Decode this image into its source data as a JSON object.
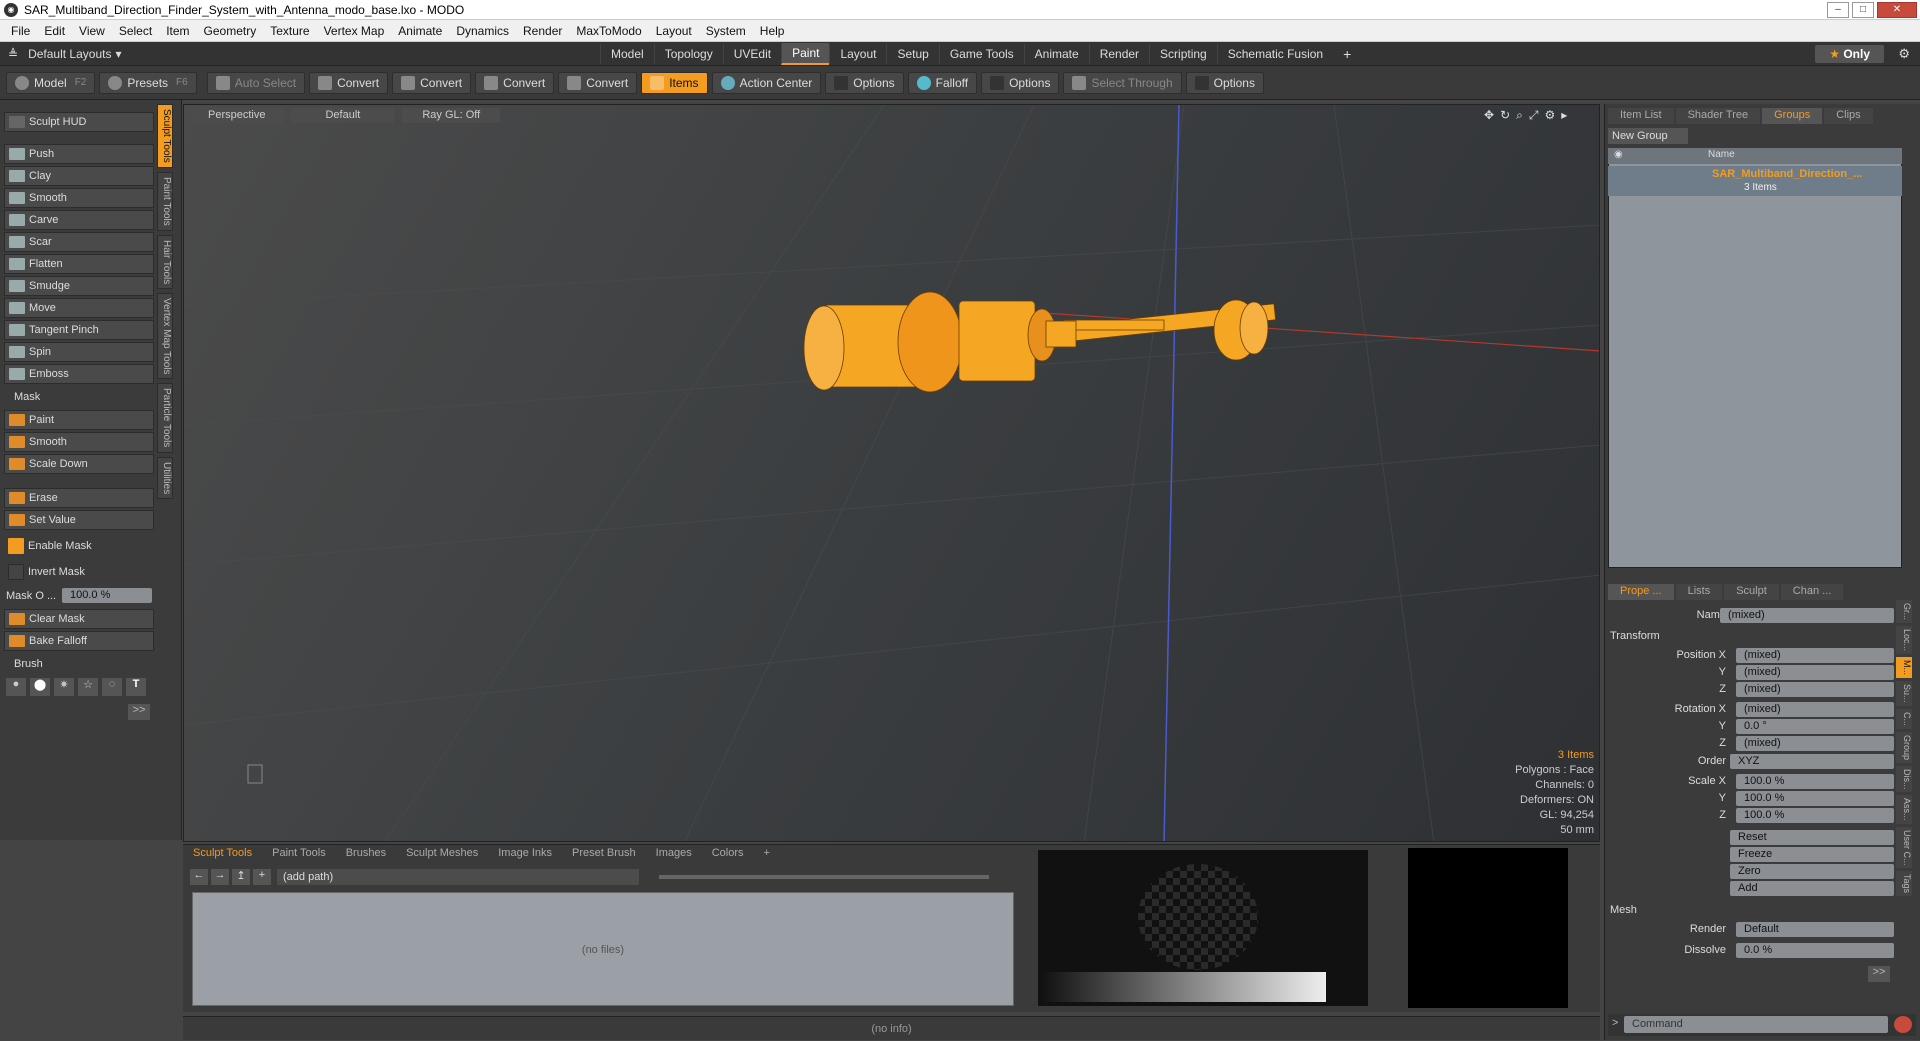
{
  "window": {
    "title": "SAR_Multiband_Direction_Finder_System_with_Antenna_modo_base.lxo - MODO"
  },
  "menu": [
    "File",
    "Edit",
    "View",
    "Select",
    "Item",
    "Geometry",
    "Texture",
    "Vertex Map",
    "Animate",
    "Dynamics",
    "Render",
    "MaxToModo",
    "Layout",
    "System",
    "Help"
  ],
  "layout": {
    "default_layouts": "Default Layouts",
    "tabs": [
      "Model",
      "Topology",
      "UVEdit",
      "Paint",
      "Layout",
      "Setup",
      "Game Tools",
      "Animate",
      "Render",
      "Scripting",
      "Schematic Fusion"
    ],
    "active_tab": "Paint",
    "only_label": "Only"
  },
  "toolbar": {
    "model": "Model",
    "model_key": "F2",
    "presets": "Presets",
    "presets_key": "F6",
    "auto_select": "Auto Select",
    "convert1": "Convert",
    "convert2": "Convert",
    "convert3": "Convert",
    "convert4": "Convert",
    "items": "Items",
    "action_center": "Action Center",
    "options1": "Options",
    "falloff": "Falloff",
    "options2": "Options",
    "select_through": "Select Through",
    "options3": "Options"
  },
  "left": {
    "hud": "Sculpt HUD",
    "tools": [
      "Push",
      "Clay",
      "Smooth",
      "Carve",
      "Scar",
      "Flatten",
      "Smudge",
      "Move",
      "Tangent Pinch",
      "Spin",
      "Emboss"
    ],
    "mask_header": "Mask",
    "mask_tools": [
      "Paint",
      "Smooth",
      "Scale Down"
    ],
    "erase": "Erase",
    "set_value": "Set Value",
    "enable_mask": "Enable Mask",
    "invert_mask": "Invert Mask",
    "mask_opacity_label": "Mask O ...",
    "mask_opacity_value": "100.0 %",
    "clear_mask": "Clear Mask",
    "bake_falloff": "Bake Falloff",
    "brush_header": "Brush",
    "vtabs": [
      "Sculpt Tools",
      "Paint Tools",
      "Hair Tools",
      "Vertex Map Tools",
      "Particle Tools",
      "Utilities"
    ]
  },
  "viewport": {
    "view": "Perspective",
    "shading": "Default",
    "raygl": "Ray GL: Off",
    "info": {
      "items": "3 Items",
      "polygons": "Polygons : Face",
      "channels": "Channels: 0",
      "deformers": "Deformers: ON",
      "gl": "GL: 94,254",
      "size": "50 mm"
    }
  },
  "bottom": {
    "tabs": [
      "Sculpt Tools",
      "Paint Tools",
      "Brushes",
      "Sculpt Meshes",
      "Image Inks",
      "Preset Brush",
      "Images",
      "Colors"
    ],
    "path": "(add path)",
    "no_files": "(no files)",
    "status": "(no info)"
  },
  "right": {
    "top_tabs": [
      "Item List",
      "Shader Tree",
      "Groups",
      "Clips"
    ],
    "new_group": "New Group",
    "name_col": "Name",
    "group_name": "SAR_Multiband_Direction_...",
    "group_count": "3 Items",
    "prop_tabs": [
      "Prope ...",
      "Lists",
      "Sculpt",
      "Chan ..."
    ],
    "name_label": "Name",
    "name_value": "(mixed)",
    "transform": "Transform",
    "position_label": "Position X",
    "pos_x": "(mixed)",
    "pos_y": "(mixed)",
    "pos_z": "(mixed)",
    "rotation_label": "Rotation X",
    "rot_x": "(mixed)",
    "rot_y": "0.0 °",
    "rot_z": "(mixed)",
    "order_label": "Order",
    "order_value": "XYZ",
    "scale_label": "Scale X",
    "scale_x": "100.0 %",
    "scale_y": "100.0 %",
    "scale_z": "100.0 %",
    "y": "Y",
    "z": "Z",
    "reset": "Reset",
    "freeze": "Freeze",
    "zero": "Zero",
    "add": "Add",
    "mesh": "Mesh",
    "render_label": "Render",
    "render_value": "Default",
    "dissolve_label": "Dissolve",
    "dissolve_value": "0.0 %",
    "command": "Command",
    "side_icons": [
      "Gr...",
      "Loc...",
      "M...",
      "Su...",
      "C...",
      "Group",
      "Dis...",
      "Ass...",
      "User C...",
      "Tags"
    ]
  },
  "colors": {
    "accent": "#f39c1f",
    "mesh_orange": "#f5a623"
  }
}
